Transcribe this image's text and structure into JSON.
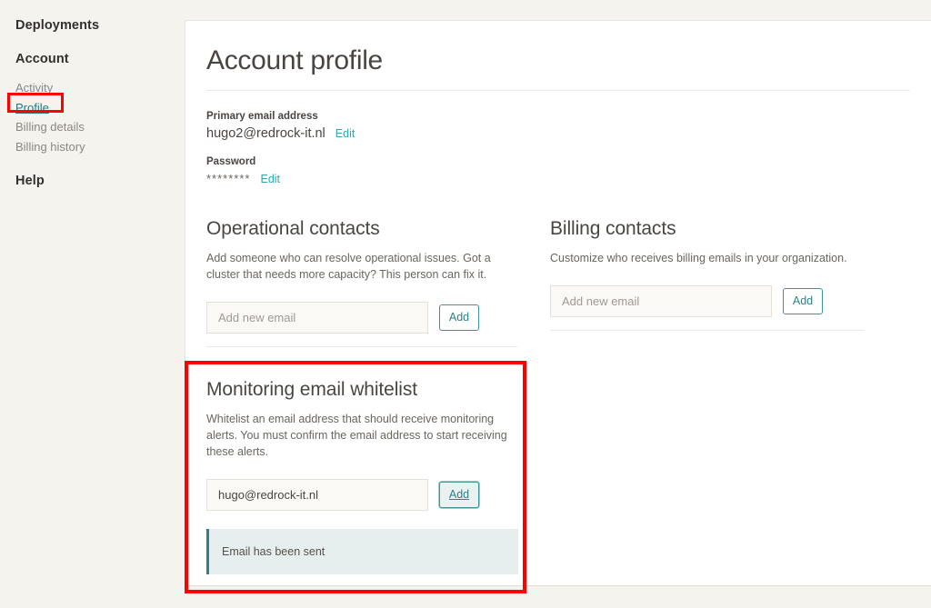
{
  "sidebar": {
    "groups": [
      {
        "label": "Deployments"
      },
      {
        "label": "Account"
      },
      {
        "label": "Help"
      }
    ],
    "account_items": [
      {
        "label": "Activity",
        "active": false
      },
      {
        "label": "Profile",
        "active": true
      },
      {
        "label": "Billing details",
        "active": false
      },
      {
        "label": "Billing history",
        "active": false
      }
    ]
  },
  "page": {
    "title": "Account profile"
  },
  "fields": {
    "email": {
      "label": "Primary email address",
      "value": "hugo2@redrock-it.nl",
      "edit_label": "Edit"
    },
    "password": {
      "label": "Password",
      "value": "********",
      "edit_label": "Edit"
    }
  },
  "operational_contacts": {
    "title": "Operational contacts",
    "description": "Add someone who can resolve operational issues. Got a cluster that needs more capacity? This person can fix it.",
    "input_placeholder": "Add new email",
    "input_value": "",
    "add_label": "Add"
  },
  "billing_contacts": {
    "title": "Billing contacts",
    "description": "Customize who receives billing emails in your organization.",
    "input_placeholder": "Add new email",
    "input_value": "",
    "add_label": "Add"
  },
  "monitoring_whitelist": {
    "title": "Monitoring email whitelist",
    "description": "Whitelist an email address that should receive monitoring alerts. You must confirm the email address to start receiving these alerts.",
    "input_placeholder": "Add new email",
    "input_value": "hugo@redrock-it.nl",
    "add_label": "Add",
    "alert_message": "Email has been sent"
  },
  "colors": {
    "accent_teal": "#2d8189",
    "link_teal": "#3aa3ac",
    "annotation_red": "#ff0000",
    "page_background": "#f5f3ee",
    "alert_background": "#e6efed"
  }
}
